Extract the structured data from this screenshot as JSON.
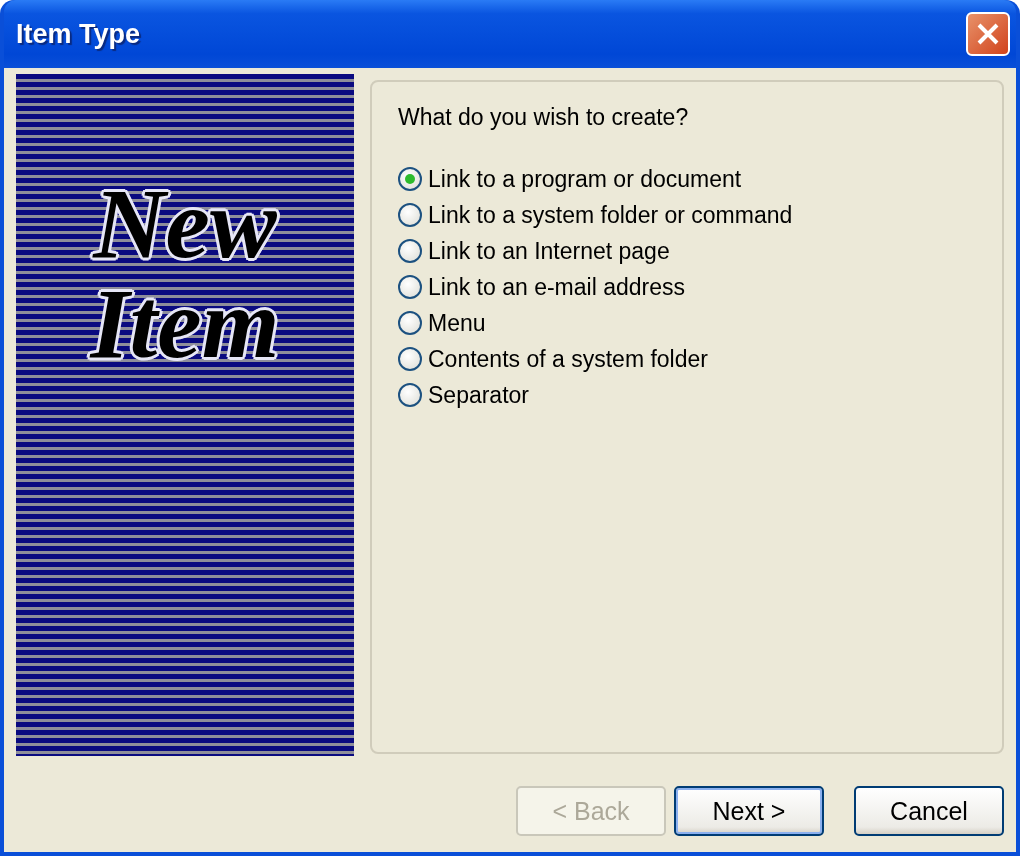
{
  "window": {
    "title": "Item Type"
  },
  "banner": {
    "text": "New Item"
  },
  "prompt": "What do you wish to create?",
  "options": [
    {
      "label": "Link to a program or document",
      "selected": true
    },
    {
      "label": "Link to a system folder or command",
      "selected": false
    },
    {
      "label": "Link to an Internet page",
      "selected": false
    },
    {
      "label": "Link to an e-mail address",
      "selected": false
    },
    {
      "label": "Menu",
      "selected": false
    },
    {
      "label": "Contents of a system folder",
      "selected": false
    },
    {
      "label": "Separator",
      "selected": false
    }
  ],
  "buttons": [
    {
      "label": "< Back",
      "disabled": true,
      "default": false
    },
    {
      "label": "Next >",
      "disabled": false,
      "default": true
    },
    {
      "label": "Cancel",
      "disabled": false,
      "default": false
    }
  ]
}
